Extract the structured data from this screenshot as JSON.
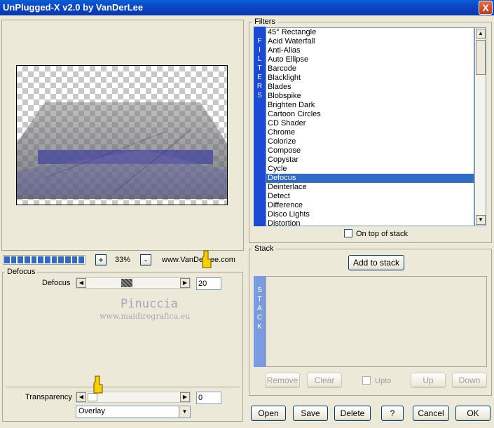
{
  "window": {
    "title": "UnPlugged-X v2.0 by VanDerLee",
    "close_glyph": "X"
  },
  "preview": {
    "zoom_minus": "-",
    "zoom_plus": "+",
    "zoom_value": "33%",
    "progress_segments": 12,
    "website": "www.VanDerLee.com"
  },
  "filters": {
    "group_title": "Filters",
    "side_label": "FILTERS",
    "items": [
      "45° Rectangle",
      "Acid Waterfall",
      "Anti-Alias",
      "Auto Ellipse",
      "Barcode",
      "Blacklight",
      "Blades",
      "Blobspike",
      "Brighten Dark",
      "Cartoon Circles",
      "CD Shader",
      "Chrome",
      "Colorize",
      "Compose",
      "Copystar",
      "Cycle",
      "Defocus",
      "Deinterlace",
      "Detect",
      "Difference",
      "Disco Lights",
      "Distortion"
    ],
    "selected": "Defocus",
    "on_top_label": "On top of stack"
  },
  "settings": {
    "group_title": "Defocus",
    "param_label": "Defocus",
    "param_value": "20",
    "param_level": 0.5,
    "watermark_name": "Pinuccia",
    "watermark_url": "www.maidiregrafica.eu",
    "transparency_label": "Transparency",
    "transparency_value": "0",
    "transparency_level": 0.0,
    "blend_mode": "Overlay"
  },
  "stack": {
    "group_title": "Stack",
    "add_button": "Add to stack",
    "side_label": "STACK",
    "remove": "Remove",
    "clear": "Clear",
    "upto": "Upto",
    "up": "Up",
    "down": "Down"
  },
  "footer": {
    "open": "Open",
    "save": "Save",
    "delete": "Delete",
    "help": "?",
    "cancel": "Cancel",
    "ok": "OK"
  },
  "colors": {
    "accent": "#316ac5",
    "title_bar": "#0b3fc1",
    "stack_strip": "#7b9be0",
    "face": "#ece9d8"
  },
  "icons": {
    "pointer": "pointing-hand-icon"
  }
}
